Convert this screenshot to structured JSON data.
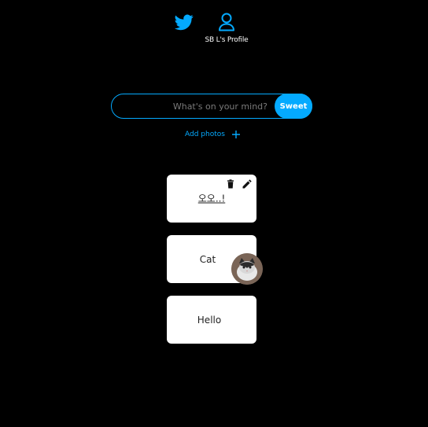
{
  "nav": {
    "home_icon": "twitter-bird-icon",
    "profile_icon": "user-icon",
    "profile_label": "SB L's Profile"
  },
  "composer": {
    "placeholder": "What's on your mind?",
    "value": "",
    "submit_label": "Sweet",
    "add_photos_label": "Add photos",
    "add_icon": "plus-icon"
  },
  "sweets": [
    {
      "text": "오오..!",
      "has_actions": true,
      "has_photo": false
    },
    {
      "text": "Cat",
      "has_actions": false,
      "has_photo": true
    },
    {
      "text": "Hello",
      "has_actions": false,
      "has_photo": false
    }
  ],
  "colors": {
    "background": "#000000",
    "accent": "#04aaff",
    "card": "#ffffff"
  }
}
